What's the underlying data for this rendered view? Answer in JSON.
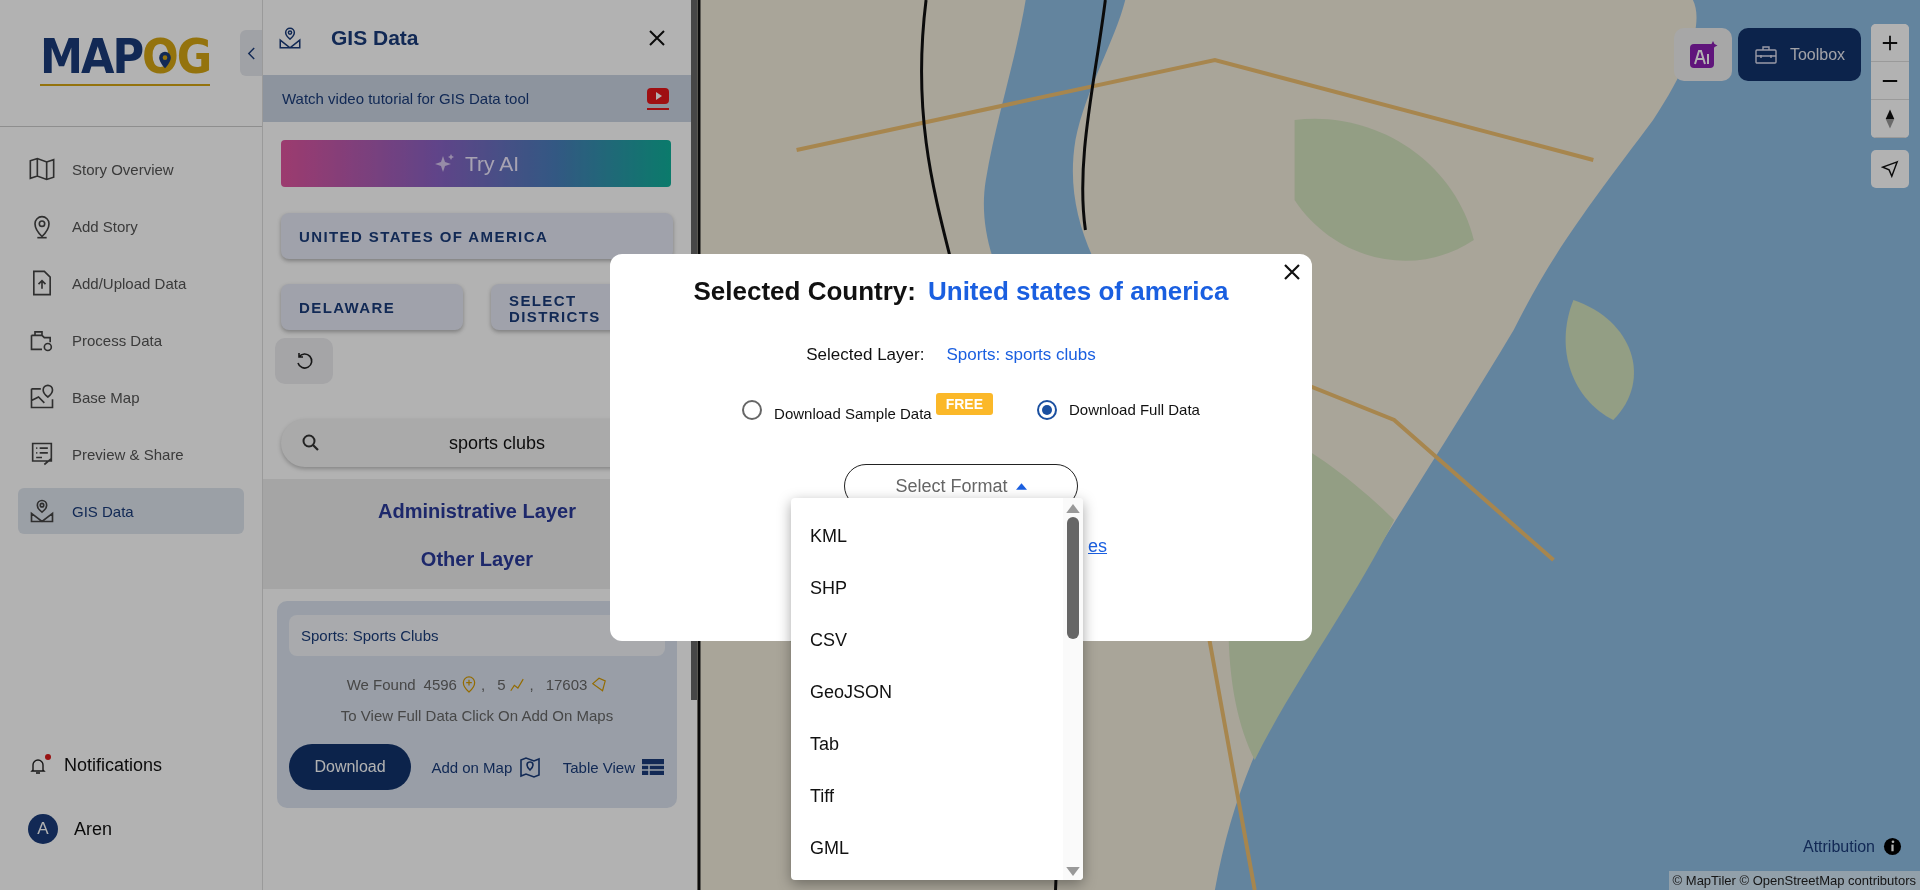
{
  "sidebar": {
    "logo": {
      "primary": "MAP",
      "accent": "OG"
    },
    "items": [
      {
        "label": "Story Overview",
        "selected": false
      },
      {
        "label": "Add Story",
        "selected": false
      },
      {
        "label": "Add/Upload Data",
        "selected": false
      },
      {
        "label": "Process Data",
        "selected": false
      },
      {
        "label": "Base Map",
        "selected": false
      },
      {
        "label": "Preview & Share",
        "selected": false
      },
      {
        "label": "GIS Data",
        "selected": true
      }
    ],
    "notifications": {
      "label": "Notifications",
      "unread": true
    },
    "user": {
      "initial": "A",
      "name": "Aren"
    }
  },
  "panel": {
    "title": "GIS Data",
    "tutorial": "Watch video tutorial for GIS Data tool",
    "try_ai": "Try AI",
    "country": "UNITED STATES OF AMERICA",
    "state": "DELAWARE",
    "districts": "SELECT DISTRICTS",
    "search": {
      "value": "sports clubs"
    },
    "layer_tabs": [
      "Administrative Layer",
      "Other Layer"
    ],
    "result": {
      "title": "Sports: Sports Clubs",
      "found_label": "We Found",
      "points": "4596",
      "lines": "5",
      "polygons": "17603",
      "separator": ",",
      "hint": "To View Full Data Click On Add On Maps",
      "download": "Download",
      "add_on_map": "Add on Map",
      "table_view": "Table View"
    }
  },
  "map": {
    "toolbox": "Toolbox",
    "attribution": "Attribution",
    "credits": "© MapTiler © OpenStreetMap contributors"
  },
  "modal": {
    "country_label": "Selected Country:",
    "country_value": "United states of america",
    "layer_label": "Selected Layer:",
    "layer_value": "Sports: sports clubs",
    "options": [
      {
        "label": "Download Sample Data",
        "badge": "FREE",
        "selected": false
      },
      {
        "label": "Download Full Data",
        "selected": true
      }
    ],
    "format_placeholder": "Select Format",
    "link_fragment": "es",
    "formats": [
      "KML",
      "SHP",
      "CSV",
      "GeoJSON",
      "Tab",
      "Tiff",
      "GML"
    ]
  }
}
